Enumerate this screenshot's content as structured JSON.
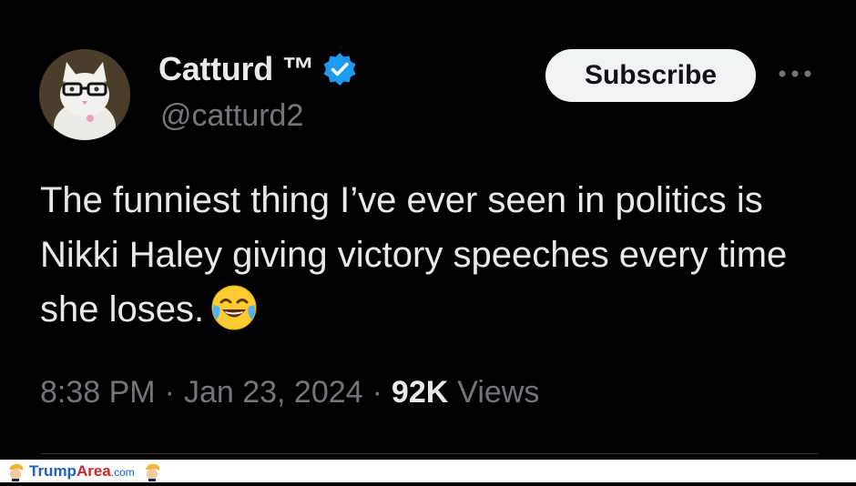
{
  "profile": {
    "display_name": "Catturd ™",
    "handle": "@catturd2",
    "verified": true,
    "avatar_icon": "cat-with-glasses-avatar"
  },
  "actions": {
    "subscribe_label": "Subscribe",
    "more_icon": "more-options-icon"
  },
  "tweet": {
    "text": "The funniest thing I’ve ever seen in politics is Nikki Haley giving victory speeches every time she loses.",
    "emoji": "face-with-tears-of-joy"
  },
  "meta": {
    "time": "8:38 PM",
    "separator": "·",
    "date": "Jan 23, 2024",
    "views_count": "92K",
    "views_label": "Views"
  },
  "watermark": {
    "brand_part1": "Trump",
    "brand_part2": "Area",
    "brand_suffix": ".com"
  },
  "colors": {
    "background": "#000000",
    "primary_text": "#e7e9ea",
    "secondary_text": "#71767b",
    "verified_blue": "#1d9bf0",
    "button_bg": "#eff3f4"
  }
}
